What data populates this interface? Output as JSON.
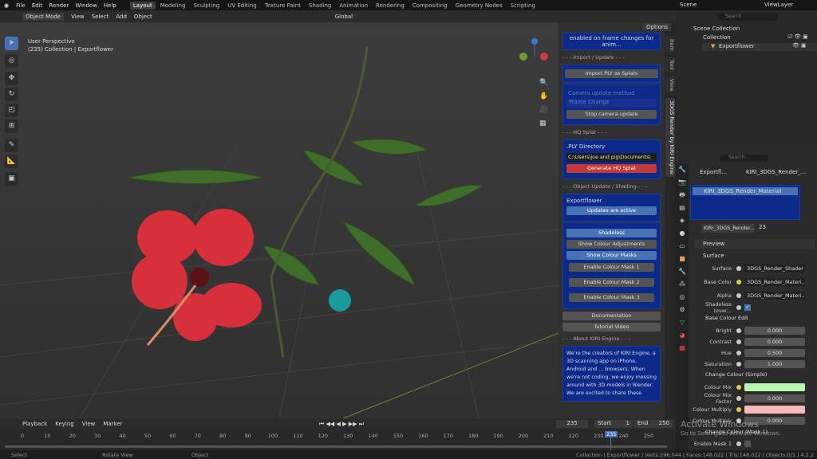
{
  "topbar": {
    "menus": [
      "File",
      "Edit",
      "Render",
      "Window",
      "Help"
    ],
    "workspaces": [
      "Layout",
      "Modeling",
      "Sculpting",
      "UV Editing",
      "Texture Paint",
      "Shading",
      "Animation",
      "Rendering",
      "Compositing",
      "Geometry Nodes",
      "Scripting"
    ],
    "active_workspace": "Layout",
    "scene": "Scene",
    "view_layer": "ViewLayer"
  },
  "header": {
    "mode": "Object Mode",
    "menus": [
      "View",
      "Select",
      "Add",
      "Object"
    ],
    "transform": "Global",
    "options": "Options"
  },
  "viewport": {
    "perspective": "User Perspective",
    "info": "(235) Collection | Exportflower"
  },
  "npanel": {
    "tabs": [
      "Item",
      "Tool",
      "View",
      "3DGS Render by KIRI Engine"
    ],
    "notice": "enabled on frame changes for anim...",
    "import_section": "- - - Import / Update - - -",
    "import_btn": "Import PLY as Splats",
    "camera_method_label": "Camera update method",
    "camera_method_value": "Frame Change",
    "stop_camera": "Stop camera update",
    "hq_section": "- - - HQ Splat - - -",
    "ply_dir_label": ".PLY Directory",
    "ply_dir_value": "C:\\Users\\joe and pig\\Documents\\",
    "generate_btn": "Generate HQ Splat",
    "object_section": "- - - Object Update / Shading - - -",
    "object_name": "Exportflower",
    "updates_btn": "Updates are active",
    "buttons": [
      "Shadeless",
      "Show Colour Adjustments",
      "Show Colour Masks"
    ],
    "mask_buttons": [
      "Enable Colour Mask 1",
      "Enable Colour Mask 2",
      "Enable Colour Mask 3"
    ],
    "documentation": "Documentation",
    "tutorial": "Tutorial Video",
    "about_section": "- - - About KIRI Engine - - -",
    "about_text": "We're the creators of KIRI Engine, a 3D scanning app on iPhone, Android and ... browsers. When we're not coding, we enjoy messing around with 3D models in Blender. We are excited to share these"
  },
  "outliner": {
    "search": "Search",
    "scene_collection": "Scene Collection",
    "collection": "Collection",
    "object": "Exportflower"
  },
  "properties": {
    "search": "Search",
    "breadcrumb_obj": "Exportfl...",
    "breadcrumb_mat": "KIRI_3DGS_Render_...",
    "slot": "KIRI_3DGS_Render_Material",
    "material": "KIRI_3DGS_Render...",
    "users": "23",
    "preview": "Preview",
    "surface_section": "Surface",
    "rows": [
      {
        "label": "Surface",
        "value": "3DGS_Render_Shader"
      },
      {
        "label": "Base Color",
        "value": "3DGS_Render_Materi..."
      },
      {
        "label": "Alpha",
        "value": "3DGS_Render_Materi..."
      }
    ],
    "shadeless_label": "Shadeless (over...",
    "base_edit": "Base Colour Edit",
    "edit_rows": [
      {
        "label": "Bright",
        "value": "0.000"
      },
      {
        "label": "Contrast",
        "value": "0.000"
      },
      {
        "label": "Hue",
        "value": "0.500"
      },
      {
        "label": "Saturation",
        "value": "1.000"
      }
    ],
    "change_colour": "Change Colour (Simple)",
    "colour_mix_label": "Colour Mix",
    "colour_mix_color": "#b8f5b0",
    "mix_factor_label": "Colour Mix Factor",
    "mix_factor": "0.000",
    "colour_multiply_label": "Colour Multiply",
    "colour_multiply_color": "#f7b8b8",
    "colour_multiply2_label": "Colour Multiply",
    "colour_multiply2": "0.000",
    "mask_section": "Change Colour (Mask 1)",
    "enable_mask": "Enable Mask 1"
  },
  "timeline": {
    "menus": [
      "Playback",
      "Keying",
      "View",
      "Marker"
    ],
    "current": "235",
    "start_label": "Start",
    "start": "1",
    "end_label": "End",
    "end": "250",
    "ticks": [
      "0",
      "10",
      "20",
      "30",
      "40",
      "50",
      "60",
      "70",
      "80",
      "90",
      "100",
      "110",
      "120",
      "130",
      "140",
      "150",
      "160",
      "170",
      "180",
      "190",
      "200",
      "210",
      "220",
      "230",
      "240",
      "250"
    ]
  },
  "status": {
    "select": "Select",
    "rotate": "Rotate View",
    "object": "Object",
    "stats": "Collection | Exportflower | Verts:296,044 | Faces:148,022 | Tris:148,022 | Objects:0/1 | 4.2.2"
  },
  "watermark": {
    "title": "Activate Windows",
    "sub": "Go to Settings to activate Windows."
  }
}
